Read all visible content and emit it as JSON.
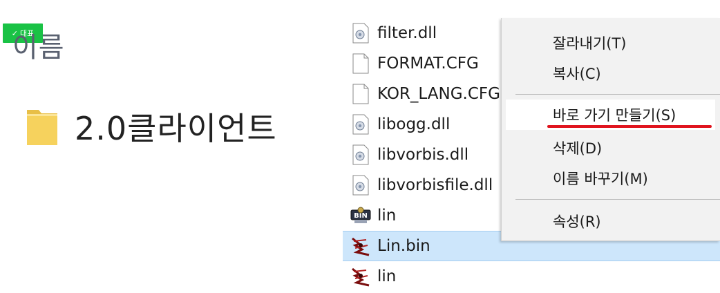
{
  "badge": {
    "label": "대표",
    "icon": "check-icon"
  },
  "left_panel": {
    "column_header": "이름",
    "folder": {
      "name": "2.0클라이언트",
      "icon": "folder-icon",
      "color": "#f6d25d"
    }
  },
  "explorer": {
    "files": [
      {
        "name": "filter.dll",
        "icon": "dll-icon"
      },
      {
        "name": "FORMAT.CFG",
        "icon": "file-icon"
      },
      {
        "name": "KOR_LANG.CFG",
        "icon": "file-icon"
      },
      {
        "name": "libogg.dll",
        "icon": "dll-icon"
      },
      {
        "name": "libvorbis.dll",
        "icon": "dll-icon"
      },
      {
        "name": "libvorbisfile.dll",
        "icon": "dll-icon"
      },
      {
        "name": "lin",
        "icon": "bin-icon"
      },
      {
        "name": "Lin.bin",
        "icon": "app-icon",
        "selected": true
      },
      {
        "name": "lin",
        "icon": "app-icon"
      }
    ],
    "selection_color": "#cde6fb"
  },
  "context_menu": {
    "items": [
      {
        "label": "잘라내기(T)"
      },
      {
        "label": "복사(C)"
      },
      {
        "label": "바로 가기 만들기(S)",
        "highlighted": true
      },
      {
        "label": "삭제(D)"
      },
      {
        "label": "이름 바꾸기(M)"
      },
      {
        "label": "속성(R)"
      }
    ],
    "underline_color": "#e0141e"
  }
}
